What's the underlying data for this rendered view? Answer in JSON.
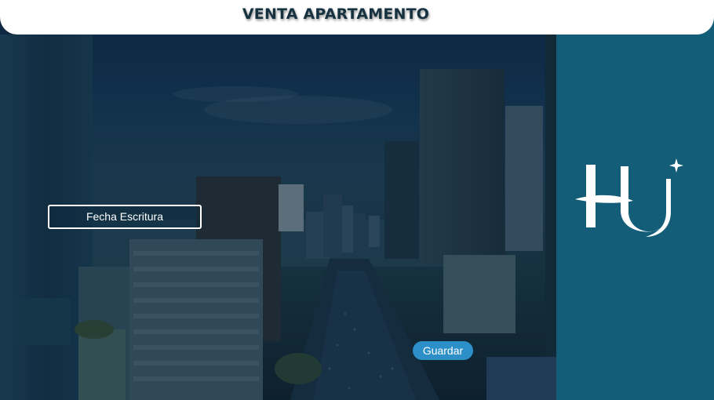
{
  "header": {
    "title": "VENTA APARTAMENTO"
  },
  "form": {
    "date_field_label": "Fecha Escritura",
    "save_label": "Guardar"
  },
  "colors": {
    "brand_panel": "#135d78",
    "save_button": "#2d8fc7",
    "header_bg": "#ffffff",
    "title_text": "#16313f"
  },
  "icons": {
    "background": "city-skyline-photo",
    "logo": "hu-monogram-logo"
  }
}
